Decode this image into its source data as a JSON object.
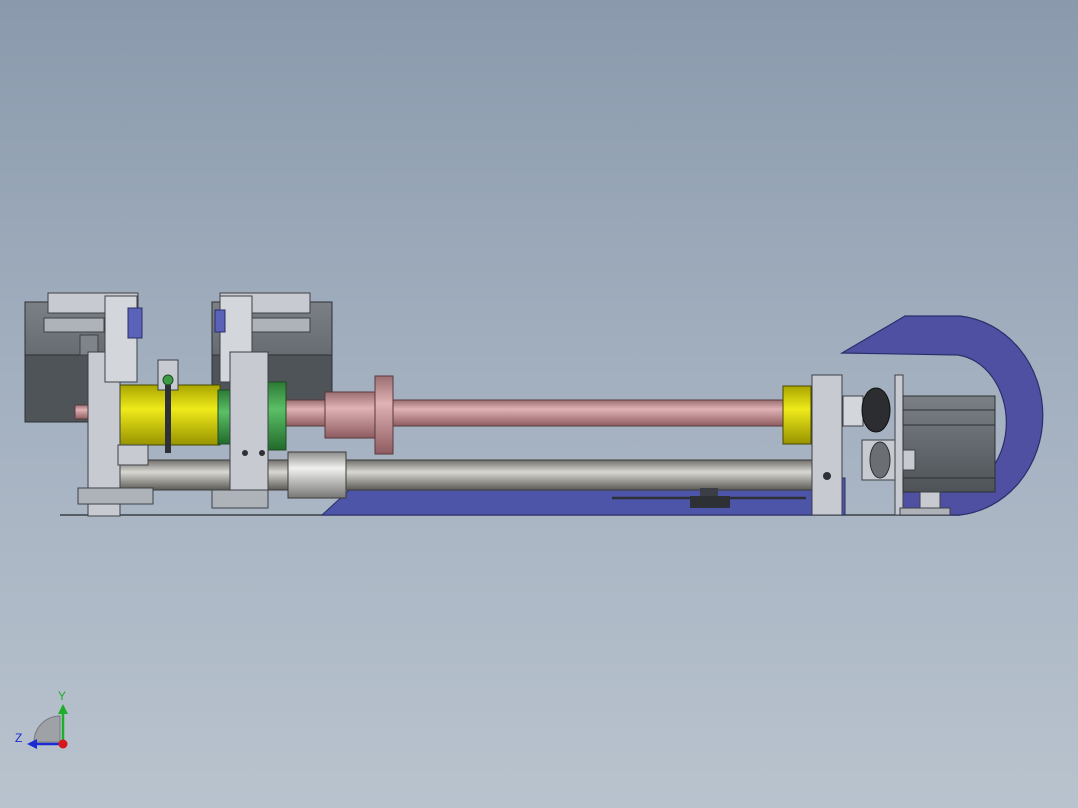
{
  "viewport": {
    "background_top": "#8a9aac",
    "background_bottom": "#b9c3ce"
  },
  "triad": {
    "y_label": "Y",
    "z_label": "Z",
    "y_color": "#1fae2a",
    "z_color": "#1c2bd1",
    "x_color": "#d8141c"
  },
  "colors": {
    "frame_gray": "#c7cbd1",
    "motor_dark": "#5c6166",
    "yellow_collar": "#d9d400",
    "green_collar": "#3c9a46",
    "pink_shaft": "#c98f93",
    "rod_gray": "#a9a8a4",
    "chain_blue": "#5050a3",
    "base_blue": "#4d55a8"
  }
}
